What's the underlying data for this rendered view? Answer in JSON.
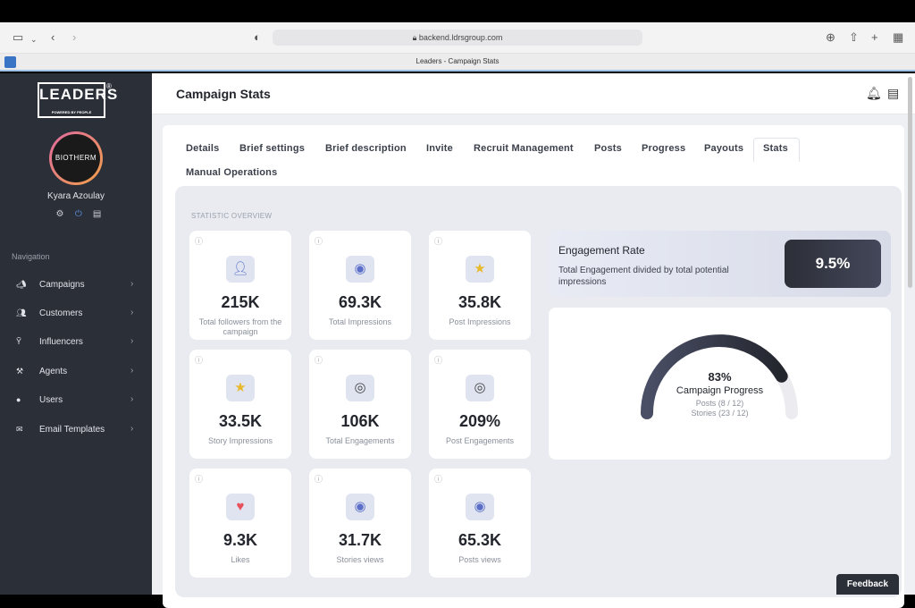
{
  "browser": {
    "url": "backend.ldrsgroup.com",
    "tab_title": "Leaders - Campaign Stats"
  },
  "sidebar": {
    "logo_text": "LEADERS",
    "logo_tagline": "POWERED BY PEOPLE",
    "avatar_text": "BIOTHERM",
    "user_name": "Kyara Azoulay",
    "nav_heading": "Navigation",
    "items": [
      {
        "label": "Campaigns",
        "icon": "megaphone-icon"
      },
      {
        "label": "Customers",
        "icon": "users-icon"
      },
      {
        "label": "Influencers",
        "icon": "person-star-icon"
      },
      {
        "label": "Agents",
        "icon": "agent-icon"
      },
      {
        "label": "Users",
        "icon": "user-circle-icon"
      },
      {
        "label": "Email Templates",
        "icon": "envelope-icon"
      }
    ]
  },
  "header": {
    "title": "Campaign Stats"
  },
  "tabs": [
    "Details",
    "Brief settings",
    "Brief description",
    "Invite",
    "Recruit Management",
    "Posts",
    "Progress",
    "Payouts",
    "Stats",
    "Manual Operations"
  ],
  "active_tab": "Stats",
  "panel": {
    "label": "STATISTIC OVERVIEW"
  },
  "stats": [
    {
      "value": "215K",
      "label": "Total followers from the campaign",
      "icon": "profile-icon"
    },
    {
      "value": "69.3K",
      "label": "Total Impressions",
      "icon": "eye-icon"
    },
    {
      "value": "35.8K",
      "label": "Post Impressions",
      "icon": "star-icon"
    },
    {
      "value": "33.5K",
      "label": "Story Impressions",
      "icon": "star-icon"
    },
    {
      "value": "106K",
      "label": "Total Engagements",
      "icon": "target-icon"
    },
    {
      "value": "209%",
      "label": "Post Engagements",
      "icon": "target-icon"
    },
    {
      "value": "9.3K",
      "label": "Likes",
      "icon": "heart-icon"
    },
    {
      "value": "31.7K",
      "label": "Stories views",
      "icon": "eye-icon"
    },
    {
      "value": "65.3K",
      "label": "Posts views",
      "icon": "eye-icon"
    }
  ],
  "engagement": {
    "title": "Engagement Rate",
    "description": "Total Engagement divided by total potential impressions",
    "value": "9.5%"
  },
  "progress": {
    "percent_text": "83%",
    "percent": 83,
    "title": "Campaign Progress",
    "posts": "Posts (8 / 12)",
    "stories": "Stories (23 / 12)"
  },
  "feedback_label": "Feedback",
  "colors": {
    "sidebar": "#2b2f38",
    "accent_dark": "#2c2f37",
    "heart": "#e8505b",
    "star": "#e8b92c",
    "eye": "#5b6fc9"
  }
}
